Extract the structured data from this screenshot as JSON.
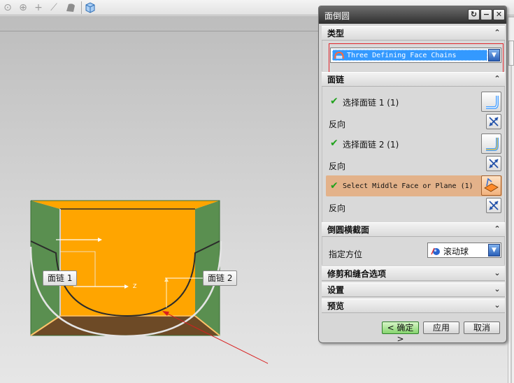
{
  "toolbar": {
    "icons": [
      "snap-circle-icon",
      "snap-target-icon",
      "crosshair-icon",
      "line-icon",
      "surface-icon",
      "cube-view-icon"
    ]
  },
  "viewport": {
    "callout_1": "面链 1",
    "callout_2": "面链 2",
    "axis_label": "Z"
  },
  "dialog": {
    "title": "面倒圆",
    "sections": {
      "type": {
        "header": "类型",
        "selected": "Three Defining Face Chains"
      },
      "face_chains": {
        "header": "面链",
        "select_chain_1": "选择面链 1 (1)",
        "reverse_1": "反向",
        "select_chain_2": "选择面链 2 (1)",
        "reverse_2": "反向",
        "select_middle": "Select Middle Face or Plane (1)",
        "reverse_3": "反向"
      },
      "cross_section": {
        "header": "倒圆横截面",
        "orientation_label": "指定方位",
        "orientation_value": "滚动球"
      },
      "trim": {
        "header": "修剪和缝合选项"
      },
      "settings": {
        "header": "设置"
      },
      "preview": {
        "header": "预览"
      }
    },
    "buttons": {
      "ok": "< 确定 >",
      "apply": "应用",
      "cancel": "取消"
    }
  },
  "colors": {
    "face_orange": "#ffa500",
    "face_green": "#5a8f50",
    "face_brown": "#6d4a26",
    "highlight_row": "#e3b28a",
    "selection_blue": "#3399ff",
    "check_green": "#20a21c",
    "callout_red": "#e0242b"
  }
}
